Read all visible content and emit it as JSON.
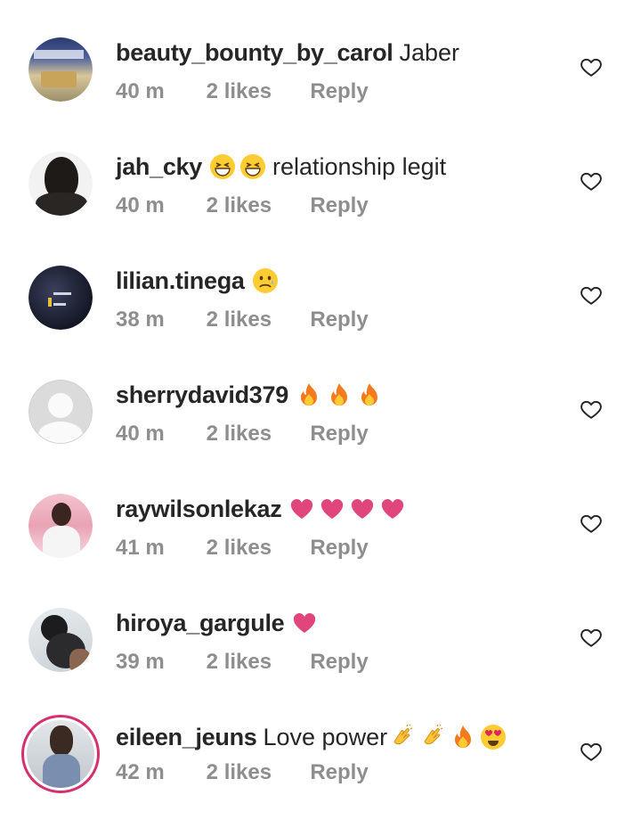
{
  "comments": [
    {
      "username": "beauty_bounty_by_carol",
      "text": "Jaber",
      "emojis": [],
      "time": "40 m",
      "likes": "2 likes",
      "reply": "Reply",
      "avatar": "product-photo"
    },
    {
      "username": "jah_cky",
      "text": "relationship legit",
      "emojis_before_text": [
        "grin",
        "grin"
      ],
      "emojis": [],
      "time": "40 m",
      "likes": "2 likes",
      "reply": "Reply",
      "avatar": "portrait-dark"
    },
    {
      "username": "lilian.tinega",
      "text": "",
      "emojis": [
        "sad"
      ],
      "time": "38 m",
      "likes": "2 likes",
      "reply": "Reply",
      "avatar": "dark-photo"
    },
    {
      "username": "sherrydavid379",
      "text": "",
      "emojis": [
        "fire",
        "fire",
        "fire"
      ],
      "time": "40 m",
      "likes": "2 likes",
      "reply": "Reply",
      "avatar": "default"
    },
    {
      "username": "raywilsonlekaz",
      "text": "",
      "emojis": [
        "heart",
        "heart",
        "heart",
        "heart"
      ],
      "time": "41 m",
      "likes": "2 likes",
      "reply": "Reply",
      "avatar": "portrait-pink"
    },
    {
      "username": "hiroya_gargule",
      "text": "",
      "emojis": [
        "heart"
      ],
      "time": "39 m",
      "likes": "2 likes",
      "reply": "Reply",
      "avatar": "hair-bun"
    },
    {
      "username": "eileen_jeuns",
      "text": "Love power",
      "emojis": [
        "clap",
        "clap",
        "fire",
        "heart-eyes"
      ],
      "time": "42 m",
      "likes": "2 likes",
      "reply": "Reply",
      "avatar": "story-ring"
    }
  ],
  "colors": {
    "username": "#262626",
    "meta": "#8e8e8e",
    "heart_emoji": "#e0457b",
    "story_ring": "#d6306f"
  },
  "icons": {
    "like": "heart-outline-icon"
  }
}
